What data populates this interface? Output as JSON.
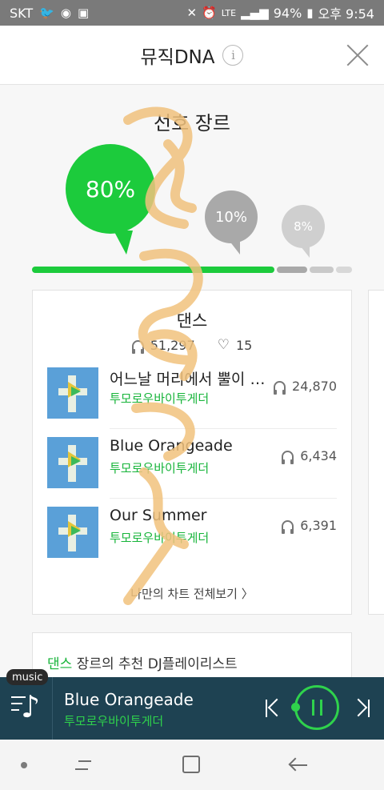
{
  "status_bar": {
    "carrier": "SKT",
    "lte": "LTE",
    "battery": "94%",
    "time": "오후 9:54"
  },
  "header": {
    "title": "뮤직DNA"
  },
  "genre": {
    "section_title": "선호 장르",
    "bubbles": [
      {
        "label": "80%",
        "color": "#1ccb3c"
      },
      {
        "label": "10%",
        "color": "#a9a9a9"
      },
      {
        "label": "8%",
        "color": "#cfcfcf"
      }
    ],
    "progress": [
      0.8,
      0.1,
      0.08
    ]
  },
  "card": {
    "genre_name": "댄스",
    "listen_count": "51,297",
    "like_count": "15",
    "tracks": [
      {
        "title": "어느날 머리에서 뿔이 자랐다",
        "artist": "투모로우바이투게더",
        "plays": "24,870"
      },
      {
        "title": "Blue Orangeade",
        "artist": "투모로우바이투게더",
        "plays": "6,434"
      },
      {
        "title": "Our Summer",
        "artist": "투모로우바이투게더",
        "plays": "6,391"
      }
    ],
    "view_all": "나만의 차트 전체보기 〉"
  },
  "dj": {
    "genre": "댄스",
    "text": " 장르의 추천 DJ플레이리스트"
  },
  "player": {
    "badge": "music",
    "title": "Blue Orangeade",
    "artist": "투모로우바이투게더"
  },
  "colors": {
    "accent": "#1ccb3c",
    "player_bg": "#1e4252"
  }
}
